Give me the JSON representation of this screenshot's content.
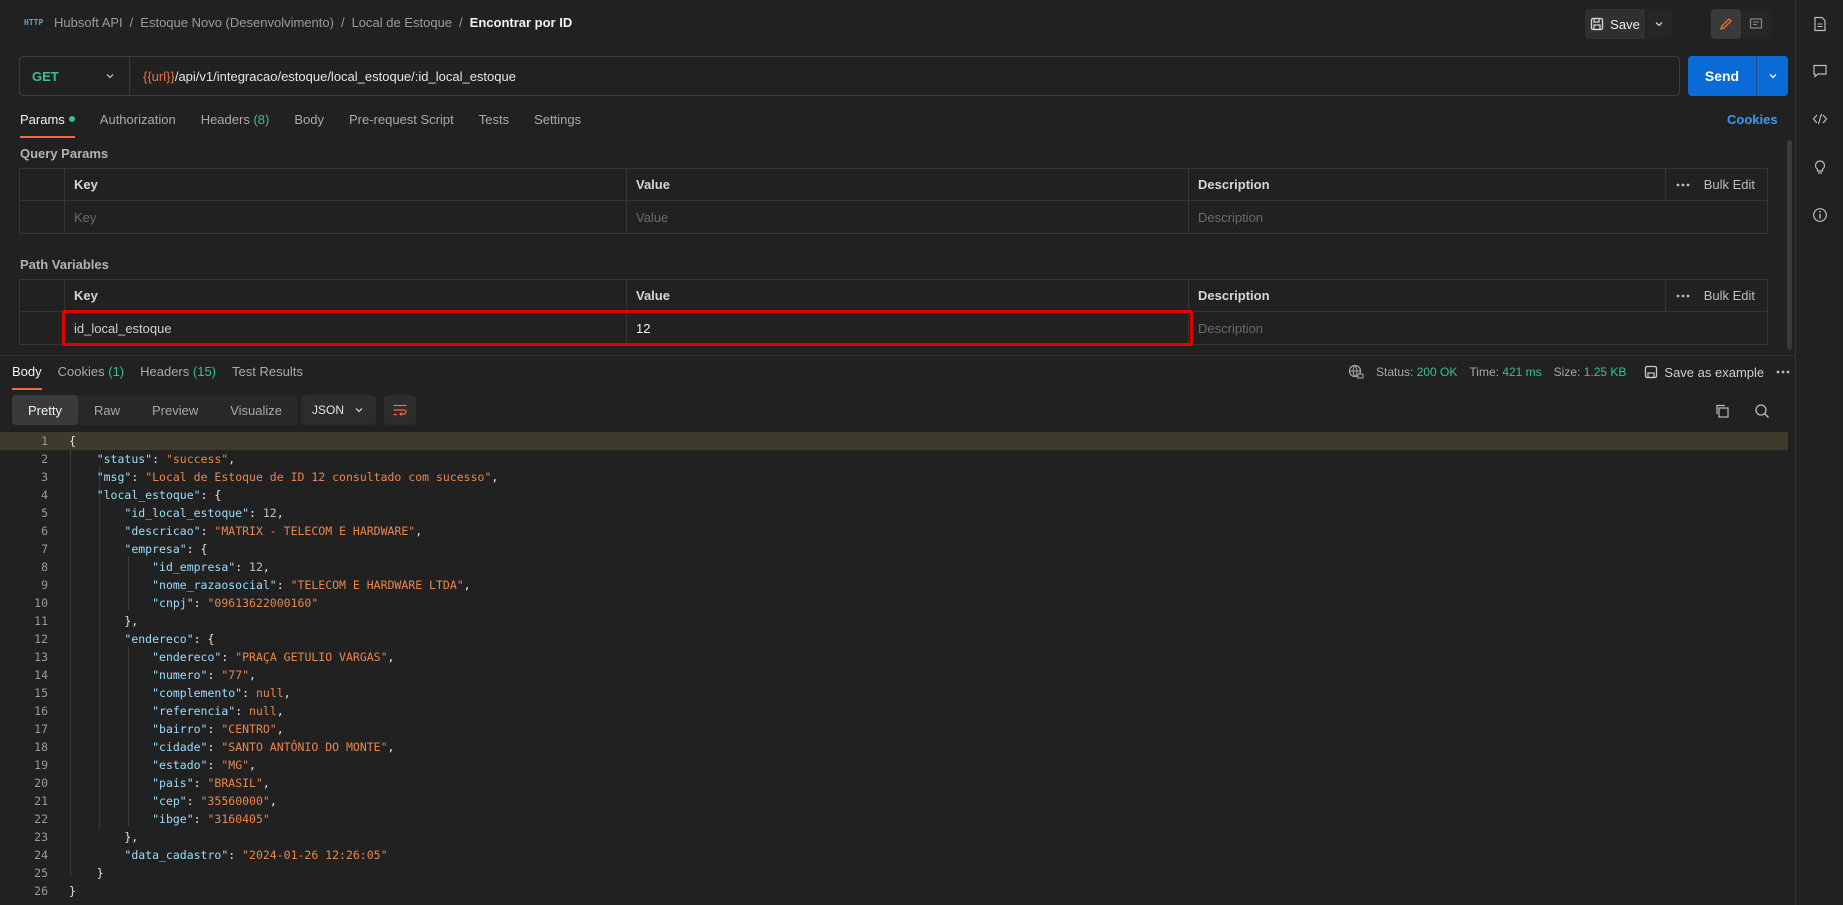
{
  "breadcrumb": {
    "items": [
      "Hubsoft API",
      "Estoque Novo (Desenvolvimento)",
      "Local de Estoque"
    ],
    "current": "Encontrar por ID",
    "separator": "/",
    "http_icon_label": "HTTP"
  },
  "header": {
    "save_label": "Save"
  },
  "request": {
    "method": "GET",
    "url_variable": "{{url}}",
    "url_path": "/api/v1/integracao/estoque/local_estoque/:id_local_estoque",
    "send_label": "Send"
  },
  "request_tabs": [
    {
      "label": "Params",
      "active": true
    },
    {
      "label": "Authorization"
    },
    {
      "label": "Headers",
      "count": "(8)"
    },
    {
      "label": "Body"
    },
    {
      "label": "Pre-request Script"
    },
    {
      "label": "Tests"
    },
    {
      "label": "Settings"
    }
  ],
  "cookies_link": "Cookies",
  "query_params": {
    "title": "Query Params",
    "headers": {
      "key": "Key",
      "value": "Value",
      "description": "Description",
      "bulk_edit": "Bulk Edit"
    },
    "placeholders": {
      "key": "Key",
      "value": "Value",
      "description": "Description"
    }
  },
  "path_variables": {
    "title": "Path Variables",
    "headers": {
      "key": "Key",
      "value": "Value",
      "description": "Description",
      "bulk_edit": "Bulk Edit"
    },
    "row": {
      "key": "id_local_estoque",
      "value": "12",
      "description_placeholder": "Description"
    }
  },
  "response_tabs": [
    {
      "label": "Body",
      "active": true
    },
    {
      "label": "Cookies",
      "count": "(1)"
    },
    {
      "label": "Headers",
      "count": "(15)"
    },
    {
      "label": "Test Results"
    }
  ],
  "response_meta": {
    "status_label": "Status:",
    "status_value": "200 OK",
    "time_label": "Time:",
    "time_value": "421 ms",
    "size_label": "Size:",
    "size_value": "1.25 KB",
    "save_example": "Save as example"
  },
  "view_tabs": [
    "Pretty",
    "Raw",
    "Preview",
    "Visualize"
  ],
  "format": "JSON",
  "code_lines": [
    [
      [
        "p",
        "{"
      ]
    ],
    [
      [
        "p",
        "    "
      ],
      [
        "k",
        "\"status\""
      ],
      [
        "p",
        ": "
      ],
      [
        "s",
        "\"success\""
      ],
      [
        "p",
        ","
      ]
    ],
    [
      [
        "p",
        "    "
      ],
      [
        "k",
        "\"msg\""
      ],
      [
        "p",
        ": "
      ],
      [
        "s",
        "\"Local de Estoque de ID 12 consultado com sucesso\""
      ],
      [
        "p",
        ","
      ]
    ],
    [
      [
        "p",
        "    "
      ],
      [
        "k",
        "\"local_estoque\""
      ],
      [
        "p",
        ": {"
      ]
    ],
    [
      [
        "p",
        "        "
      ],
      [
        "k",
        "\"id_local_estoque\""
      ],
      [
        "p",
        ": "
      ],
      [
        "n",
        "12"
      ],
      [
        "p",
        ","
      ]
    ],
    [
      [
        "p",
        "        "
      ],
      [
        "k",
        "\"descricao\""
      ],
      [
        "p",
        ": "
      ],
      [
        "s",
        "\"MATRIX - TELECOM E HARDWARE\""
      ],
      [
        "p",
        ","
      ]
    ],
    [
      [
        "p",
        "        "
      ],
      [
        "k",
        "\"empresa\""
      ],
      [
        "p",
        ": {"
      ]
    ],
    [
      [
        "p",
        "            "
      ],
      [
        "k",
        "\"id_empresa\""
      ],
      [
        "p",
        ": "
      ],
      [
        "n",
        "12"
      ],
      [
        "p",
        ","
      ]
    ],
    [
      [
        "p",
        "            "
      ],
      [
        "k",
        "\"nome_razaosocial\""
      ],
      [
        "p",
        ": "
      ],
      [
        "s",
        "\"TELECOM E HARDWARE LTDA\""
      ],
      [
        "p",
        ","
      ]
    ],
    [
      [
        "p",
        "            "
      ],
      [
        "k",
        "\"cnpj\""
      ],
      [
        "p",
        ": "
      ],
      [
        "s",
        "\"09613622000160\""
      ]
    ],
    [
      [
        "p",
        "        },"
      ]
    ],
    [
      [
        "p",
        "        "
      ],
      [
        "k",
        "\"endereco\""
      ],
      [
        "p",
        ": {"
      ]
    ],
    [
      [
        "p",
        "            "
      ],
      [
        "k",
        "\"endereco\""
      ],
      [
        "p",
        ": "
      ],
      [
        "s",
        "\"PRAÇA GETULIO VARGAS\""
      ],
      [
        "p",
        ","
      ]
    ],
    [
      [
        "p",
        "            "
      ],
      [
        "k",
        "\"numero\""
      ],
      [
        "p",
        ": "
      ],
      [
        "s",
        "\"77\""
      ],
      [
        "p",
        ","
      ]
    ],
    [
      [
        "p",
        "            "
      ],
      [
        "k",
        "\"complemento\""
      ],
      [
        "p",
        ": "
      ],
      [
        "nl",
        "null"
      ],
      [
        "p",
        ","
      ]
    ],
    [
      [
        "p",
        "            "
      ],
      [
        "k",
        "\"referencia\""
      ],
      [
        "p",
        ": "
      ],
      [
        "nl",
        "null"
      ],
      [
        "p",
        ","
      ]
    ],
    [
      [
        "p",
        "            "
      ],
      [
        "k",
        "\"bairro\""
      ],
      [
        "p",
        ": "
      ],
      [
        "s",
        "\"CENTRO\""
      ],
      [
        "p",
        ","
      ]
    ],
    [
      [
        "p",
        "            "
      ],
      [
        "k",
        "\"cidade\""
      ],
      [
        "p",
        ": "
      ],
      [
        "s",
        "\"SANTO ANTÔNIO DO MONTE\""
      ],
      [
        "p",
        ","
      ]
    ],
    [
      [
        "p",
        "            "
      ],
      [
        "k",
        "\"estado\""
      ],
      [
        "p",
        ": "
      ],
      [
        "s",
        "\"MG\""
      ],
      [
        "p",
        ","
      ]
    ],
    [
      [
        "p",
        "            "
      ],
      [
        "k",
        "\"pais\""
      ],
      [
        "p",
        ": "
      ],
      [
        "s",
        "\"BRASIL\""
      ],
      [
        "p",
        ","
      ]
    ],
    [
      [
        "p",
        "            "
      ],
      [
        "k",
        "\"cep\""
      ],
      [
        "p",
        ": "
      ],
      [
        "s",
        "\"35560000\""
      ],
      [
        "p",
        ","
      ]
    ],
    [
      [
        "p",
        "            "
      ],
      [
        "k",
        "\"ibge\""
      ],
      [
        "p",
        ": "
      ],
      [
        "s",
        "\"3160405\""
      ]
    ],
    [
      [
        "p",
        "        },"
      ]
    ],
    [
      [
        "p",
        "        "
      ],
      [
        "k",
        "\"data_cadastro\""
      ],
      [
        "p",
        ": "
      ],
      [
        "s",
        "\"2024-01-26 12:26:05\""
      ]
    ],
    [
      [
        "p",
        "    }"
      ]
    ],
    [
      [
        "p",
        "}"
      ]
    ]
  ],
  "colors": {
    "accent": "#ef6c35",
    "send": "#0b6bd6",
    "success": "#35c28b",
    "highlight": "#e00000"
  }
}
